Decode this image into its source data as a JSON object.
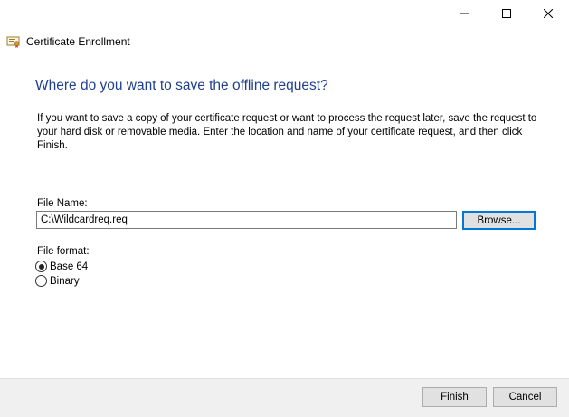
{
  "window": {
    "title": "Certificate Enrollment",
    "controls": {
      "minimize_icon": "minimize-icon",
      "maximize_icon": "maximize-icon",
      "close_icon": "close-icon"
    }
  },
  "page": {
    "heading": "Where do you want to save the offline request?",
    "description": "If you want to save a copy of your certificate request or want to process the request later, save the request to your hard disk or removable media. Enter the location and name of your certificate request, and then click Finish."
  },
  "file_name": {
    "label": "File Name:",
    "value": "C:\\Wildcardreq.req"
  },
  "browse_button": {
    "label": "Browse..."
  },
  "file_format": {
    "label": "File format:",
    "options": [
      {
        "label": "Base 64",
        "checked": true
      },
      {
        "label": "Binary",
        "checked": false
      }
    ]
  },
  "footer": {
    "finish_label": "Finish",
    "cancel_label": "Cancel"
  },
  "colors": {
    "heading": "#1f3f8f",
    "focus_border": "#0078d7",
    "footer_bg": "#f0f0f0",
    "button_bg": "#e1e1e1"
  },
  "icons": {
    "app_icon": "certificate-icon"
  }
}
